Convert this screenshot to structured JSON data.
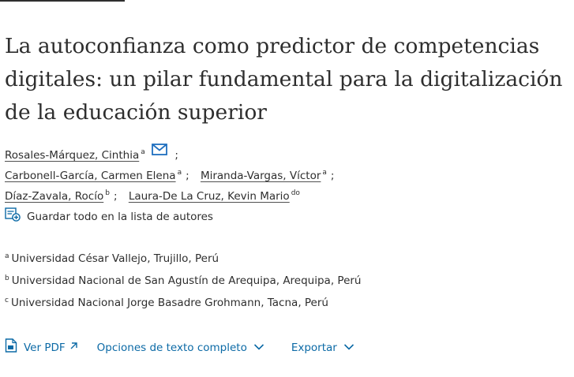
{
  "article": {
    "title": "La autoconfianza como predictor de competencias digitales: un pilar fundamental para la digitalización de la educación superior"
  },
  "authors": [
    {
      "name": "Rosales-Márquez, Cinthia",
      "sup": "a"
    },
    {
      "name": "Carbonell-García, Carmen Elena",
      "sup": "a"
    },
    {
      "name": "Miranda-Vargas, Víctor",
      "sup": "a"
    },
    {
      "name": "Díaz-Zavala, Rocío",
      "sup": "b"
    },
    {
      "name": "Laura-De La Cruz, Kevin Mario",
      "sup": "do"
    }
  ],
  "separator": ";",
  "save_all_label": "Guardar todo en la lista de autores",
  "affiliations": [
    {
      "sup": "a",
      "text": "Universidad César Vallejo, Trujillo, Perú"
    },
    {
      "sup": "b",
      "text": "Universidad Nacional de San Agustín de Arequipa, Arequipa, Perú"
    },
    {
      "sup": "c",
      "text": "Universidad Nacional Jorge Basadre Grohmann, Tacna, Perú"
    }
  ],
  "actions": {
    "view_pdf": "Ver PDF",
    "full_text_options": "Opciones de texto completo",
    "export": "Exportar"
  },
  "icons": {
    "mail": "envelope-icon",
    "save": "add-to-list-icon",
    "pdf": "pdf-document-icon",
    "external": "external-arrow-icon",
    "chevron": "chevron-down-icon"
  },
  "colors": {
    "text": "#2e2e2e",
    "link": "#0c6aa6",
    "mail_icon": "#1f6fbf"
  }
}
